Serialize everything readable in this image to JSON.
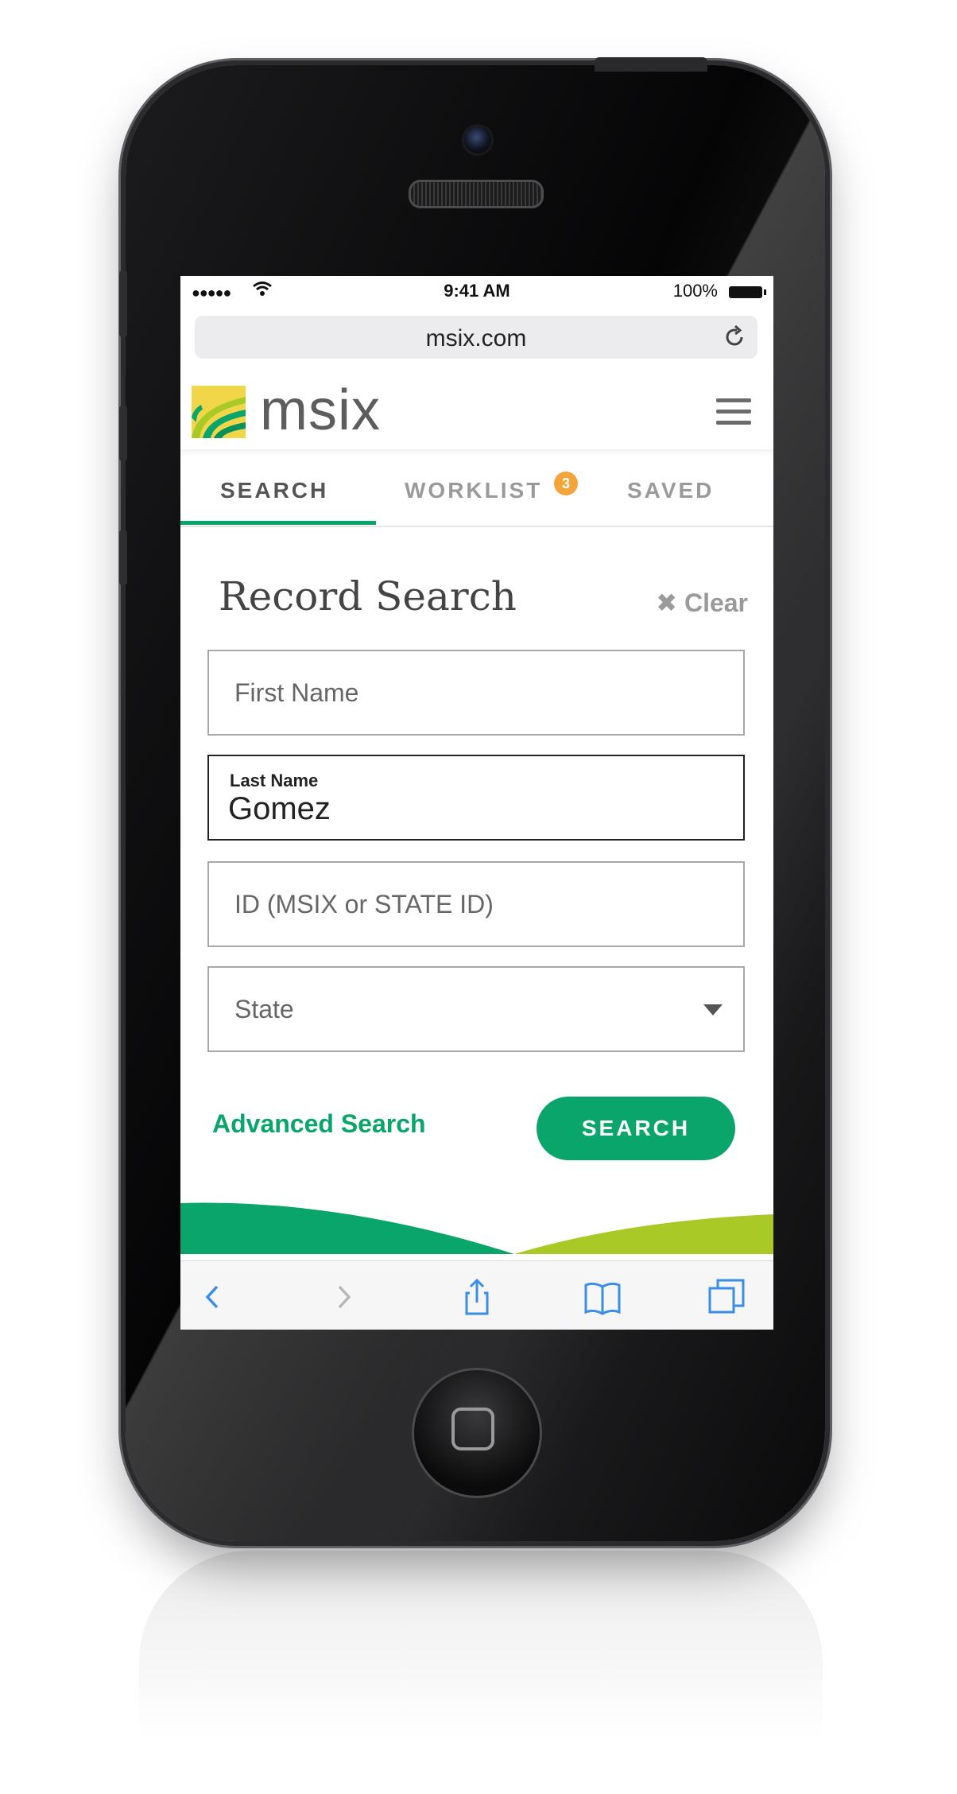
{
  "status_bar": {
    "signal": "●●●●●",
    "time": "9:41 AM",
    "battery": "100%"
  },
  "browser": {
    "url": "msix.com"
  },
  "brand": {
    "logo_text": "msix"
  },
  "tabs": [
    {
      "label": "SEARCH",
      "active": true
    },
    {
      "label": "WORKLIST",
      "badge": "3"
    },
    {
      "label": "SAVED"
    }
  ],
  "form": {
    "title": "Record Search",
    "clear_label": "Clear",
    "first_name": {
      "placeholder": "First Name",
      "value": ""
    },
    "last_name": {
      "label": "Last Name",
      "value": "Gomez"
    },
    "id_field": {
      "placeholder": "ID (MSIX or STATE ID)",
      "value": ""
    },
    "state": {
      "placeholder": "State"
    },
    "advanced_link": "Advanced Search",
    "search_button": "SEARCH"
  },
  "colors": {
    "accent_green": "#0aa56b",
    "lime": "#a8c926",
    "badge_orange": "#f3a53a"
  },
  "icons": {
    "browser_toolbar": [
      "back-icon",
      "forward-icon",
      "share-icon",
      "bookmarks-icon",
      "tabs-icon"
    ]
  }
}
